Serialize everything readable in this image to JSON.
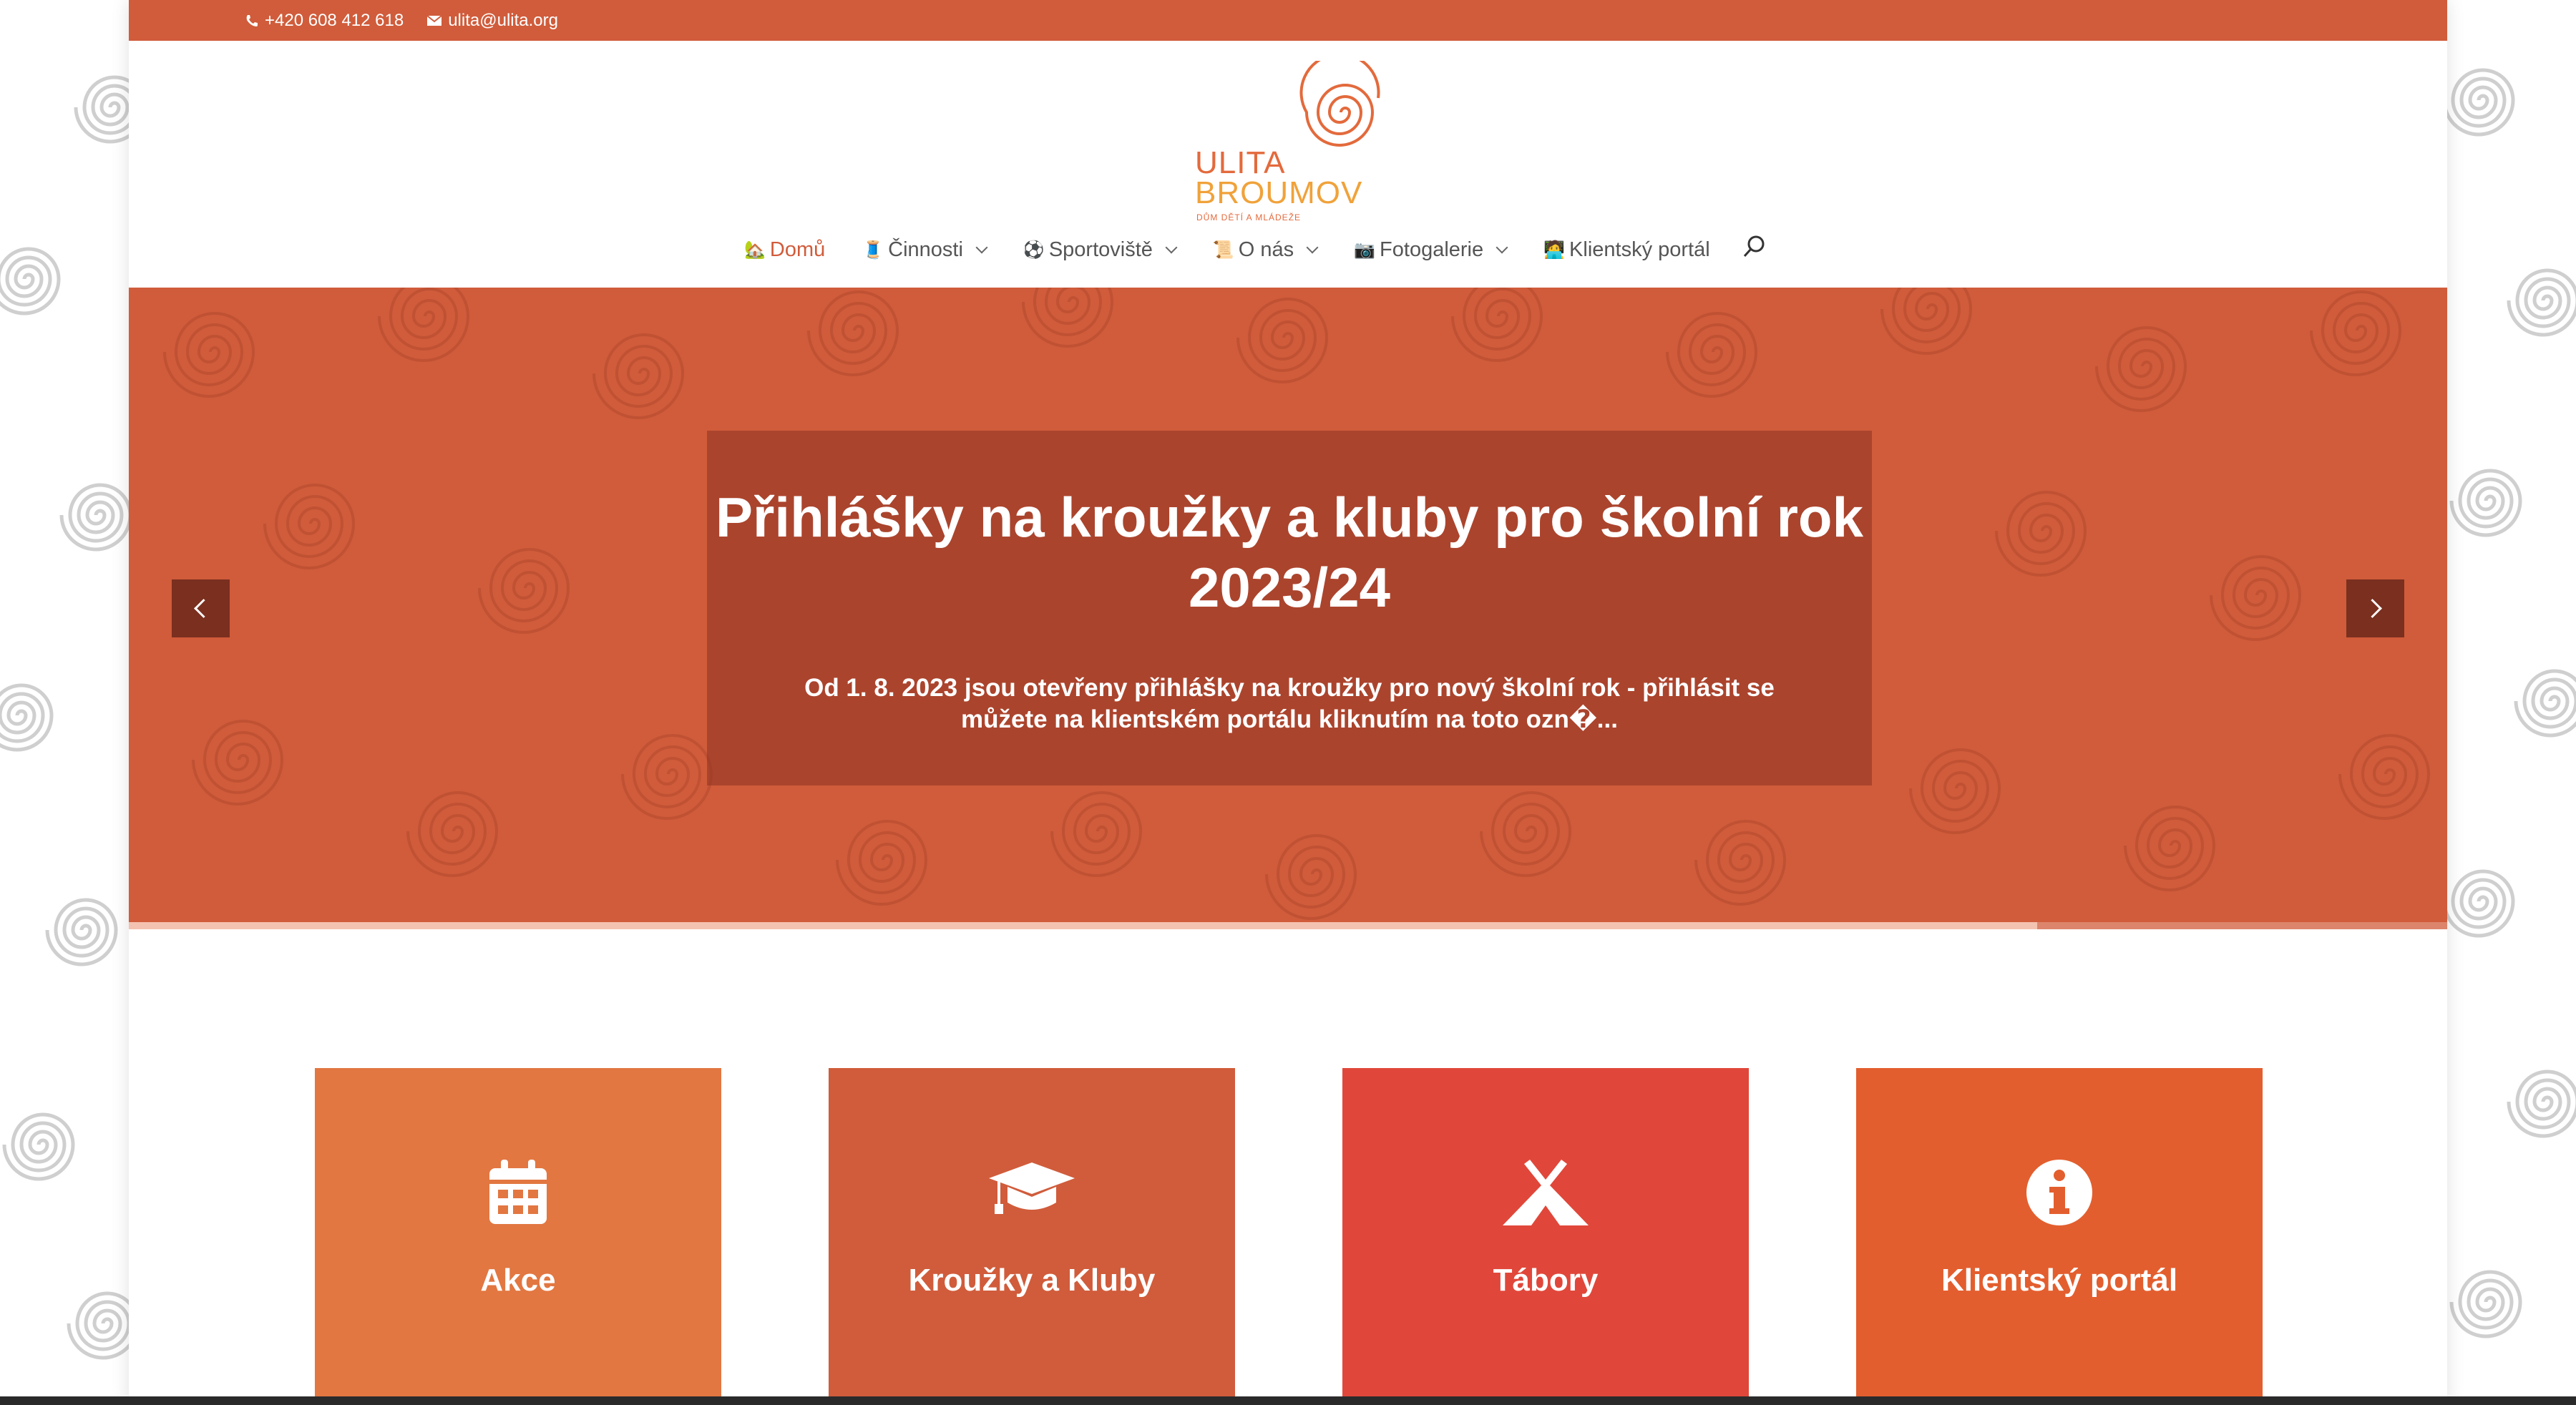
{
  "topbar": {
    "phone": "+420 608 412 618",
    "email": "ulita@ulita.org",
    "color": "#d05c3b"
  },
  "logo": {
    "line1": "ULITA",
    "line2": "BROUMOV",
    "tagline": "DŮM DĚTÍ A MLÁDEŽE"
  },
  "nav": {
    "items": [
      {
        "label": "Domů",
        "icon": "🏡",
        "active": true
      },
      {
        "label": "Činnosti",
        "icon": "🧵",
        "dropdown": true
      },
      {
        "label": "Sportoviště",
        "icon": "⚽",
        "dropdown": true
      },
      {
        "label": "O nás",
        "icon": "📜",
        "dropdown": true
      },
      {
        "label": "Fotogalerie",
        "icon": "📷",
        "dropdown": true
      },
      {
        "label": "Klientský portál",
        "icon": "🧑‍💻"
      }
    ],
    "search_icon": "search-icon"
  },
  "hero": {
    "title": "Přihlášky na kroužky a kluby pro školní rok 2023/24",
    "text": "Od 1. 8. 2023 jsou otevřeny přihlášky na kroužky pro nový školní rok - přihlásit se můžete na klientském portálu kliknutím na toto ozn�...",
    "progress": 0.823,
    "color": "#d05c3b"
  },
  "cards": [
    {
      "label": "Akce",
      "icon": "calendar-icon",
      "color": "#e27741"
    },
    {
      "label": "Kroužky a Kluby",
      "icon": "graduation-cap-icon",
      "color": "#d05c3b"
    },
    {
      "label": "Tábory",
      "icon": "tent-icon",
      "color": "#e0473a"
    },
    {
      "label": "Klientský portál",
      "icon": "info-icon",
      "color": "#e35e2e"
    }
  ]
}
